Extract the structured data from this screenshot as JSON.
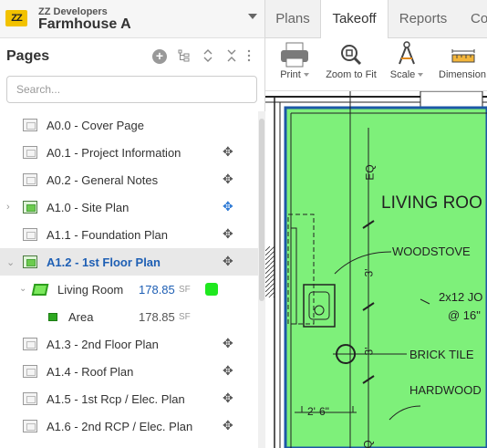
{
  "project": {
    "logo_text": "ZZ",
    "company": "ZZ Developers",
    "name": "Farmhouse A"
  },
  "pages_panel": {
    "title": "Pages",
    "search_placeholder": "Search...",
    "items": [
      {
        "label": "A0.0 - Cover Page",
        "move": false
      },
      {
        "label": "A0.1 - Project Information",
        "move": true
      },
      {
        "label": "A0.2 - General Notes",
        "move": true
      },
      {
        "label": "A1.0 - Site Plan",
        "move": true
      },
      {
        "label": "A1.1 - Foundation Plan",
        "move": true
      },
      {
        "label": "A1.2 - 1st Floor Plan",
        "move": true
      },
      {
        "label": "A1.3 - 2nd Floor Plan",
        "move": true
      },
      {
        "label": "A1.4 - Roof Plan",
        "move": true
      },
      {
        "label": "A1.5 - 1st Rcp / Elec. Plan",
        "move": true
      },
      {
        "label": "A1.6 - 2nd RCP / Elec. Plan",
        "move": true
      }
    ],
    "takeoff": {
      "name": "Living Room",
      "quantity": "178.85",
      "unit": "SF",
      "color": "#1fe81f",
      "sub": {
        "name": "Area",
        "quantity": "178.85",
        "unit": "SF"
      }
    }
  },
  "tabs": [
    "Plans",
    "Takeoff",
    "Reports",
    "Co"
  ],
  "active_tab": "Takeoff",
  "toolbar": {
    "print": "Print",
    "zoom": "Zoom to Fit",
    "scale": "Scale",
    "dimension": "Dimension"
  },
  "drawing": {
    "room_label": "LIVING ROO",
    "notes": [
      "WOODSTOVE",
      "BRICK TILE",
      "HARDWOOD"
    ],
    "beam_note_1": "2x12 JO",
    "beam_note_2": "@ 16\"",
    "dims": [
      "EQ",
      "3'",
      "3'",
      "2'-6\"",
      "Q"
    ],
    "fill_color": "#7ef07a"
  }
}
